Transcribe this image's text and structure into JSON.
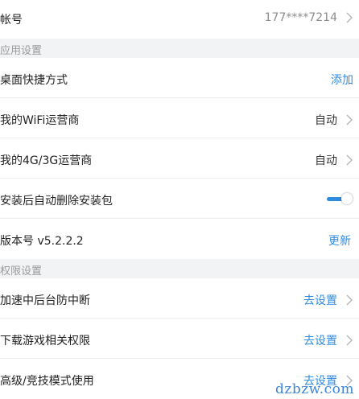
{
  "account": {
    "label": "帐号",
    "value": "177****7214"
  },
  "app_settings": {
    "section_title": "应用设置",
    "desktop_shortcut": {
      "label": "桌面快捷方式",
      "action": "添加"
    },
    "wifi_carrier": {
      "label": "我的WiFi运营商",
      "value": "自动"
    },
    "mobile_carrier": {
      "label": "我的4G/3G运营商",
      "value": "自动"
    },
    "auto_delete": {
      "label": "安装后自动删除安装包",
      "enabled": true
    },
    "version": {
      "label": "版本号 v5.2.2.2",
      "action": "更新"
    }
  },
  "permissions": {
    "section_title": "权限设置",
    "background": {
      "label": "加速中后台防中断",
      "action": "去设置"
    },
    "download": {
      "label": "下载游戏相关权限",
      "action": "去设置"
    },
    "competitive": {
      "label": "高级/竞技模式使用",
      "action": "去设置"
    }
  },
  "watermark": "dzbzw.com",
  "colors": {
    "accent": "#2f8be0",
    "section_bg": "#f2f3f5",
    "label": "#222222"
  }
}
